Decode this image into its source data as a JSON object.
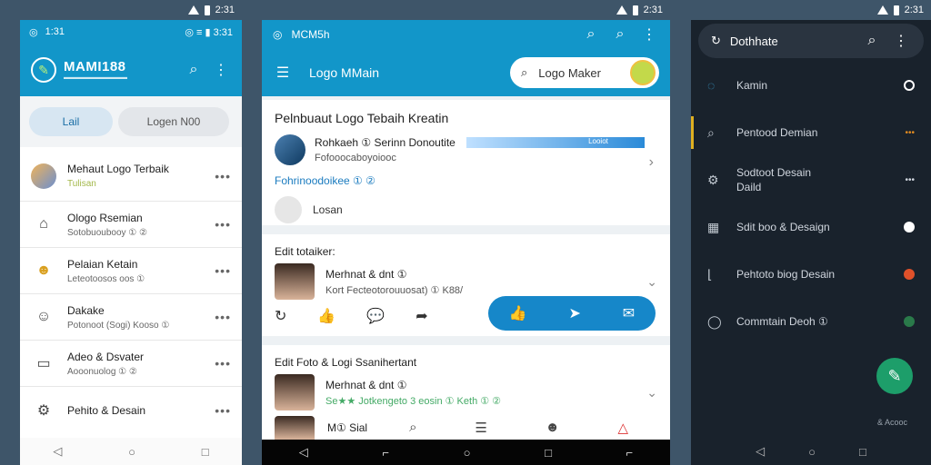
{
  "status_bar": {
    "time": "2:31"
  },
  "phone1": {
    "status": {
      "time": "1:31",
      "icons": "◎ ≡ ▮ 3:31"
    },
    "appbar": {
      "brand": "MAMI188",
      "brand_sub": "▬▬▬▬▬▬▬▬▬▬"
    },
    "tabs": [
      {
        "label": "Lail"
      },
      {
        "label": "Logen N00"
      }
    ],
    "list": [
      {
        "title": "Mehaut Logo Terbaik",
        "sub": "Tulisan",
        "icon": "avatar"
      },
      {
        "title": "Ologo Rsemian",
        "sub": "Sotobuoubooy ① ②",
        "icon": "home-icon"
      },
      {
        "title": "Pelaian Ketain",
        "sub": "Leteotoosos oos ①",
        "icon": "emoji-icon"
      },
      {
        "title": "Dakake",
        "sub": "Potonoot (Sogi) Kooso ①",
        "icon": "smile-icon"
      },
      {
        "title": "Adeo & Dsvater",
        "sub": "Aooonuolog ① ②",
        "icon": "folder-icon"
      },
      {
        "title": "Pehito & Desain",
        "sub": "",
        "icon": "settings-icon"
      }
    ],
    "nav": [
      "◁",
      "○",
      "□"
    ]
  },
  "phone2": {
    "bar1": {
      "title": "MCM5h",
      "icons": [
        "search-icon",
        "search-icon",
        "more-icon"
      ]
    },
    "bar2": {
      "title": "Logo MMain",
      "search_value": "Logo Maker"
    },
    "card1": {
      "heading": "Pelnbuaut Logo Tebaih Kreatin",
      "name": "Rohkaeh ① Serinn Donoutite",
      "bar_text": "Looiot",
      "sub": "Fofooocaboyoiooc",
      "link": "Fohrinoodoikee ① ②",
      "extra": "Losan"
    },
    "card2": {
      "heading": "Edit totaiker:",
      "name": "Merhnat & dnt ①",
      "sub": "Kort Fecteotorouuosat) ① K88/"
    },
    "card3": {
      "heading": "Edit Foto & Logi Ssanihertant",
      "name": "Merhnat & dnt ①",
      "sub": "Se★★ Jotkengeto 3 eosin ① Keth ① ②",
      "mini_name": "M① Sial"
    },
    "nav": [
      "◁",
      "⌐",
      "○",
      "□",
      "⌐"
    ]
  },
  "phone3": {
    "top": {
      "title": "Dothhate"
    },
    "items": [
      {
        "label": "Kamin",
        "sub": "",
        "icon": "chat-icon",
        "dot": "#ffffff"
      },
      {
        "label": "Pentood Demian",
        "sub": "",
        "icon": "search-icon",
        "dot": "#e08a20"
      },
      {
        "label": "Sodtoot Desain",
        "sub": "Daild",
        "icon": "cog-icon",
        "dot": ""
      },
      {
        "label": "Sdit boo & Desaign",
        "sub": "",
        "icon": "grid-icon",
        "dot": "#ffffff"
      },
      {
        "label": "Pehtoto biog Desain",
        "sub": "",
        "icon": "bracket-icon",
        "dot": "#e0512a"
      },
      {
        "label": "Commtain Deoh ①",
        "sub": "",
        "icon": "search-icon",
        "dot": "#2a7a4a"
      }
    ],
    "footer": "& Acooc",
    "nav": [
      "◁",
      "○",
      "□"
    ]
  },
  "colors": {
    "blue": "#1296c9",
    "dark": "#19222c",
    "fab": "#1d9e6a"
  }
}
